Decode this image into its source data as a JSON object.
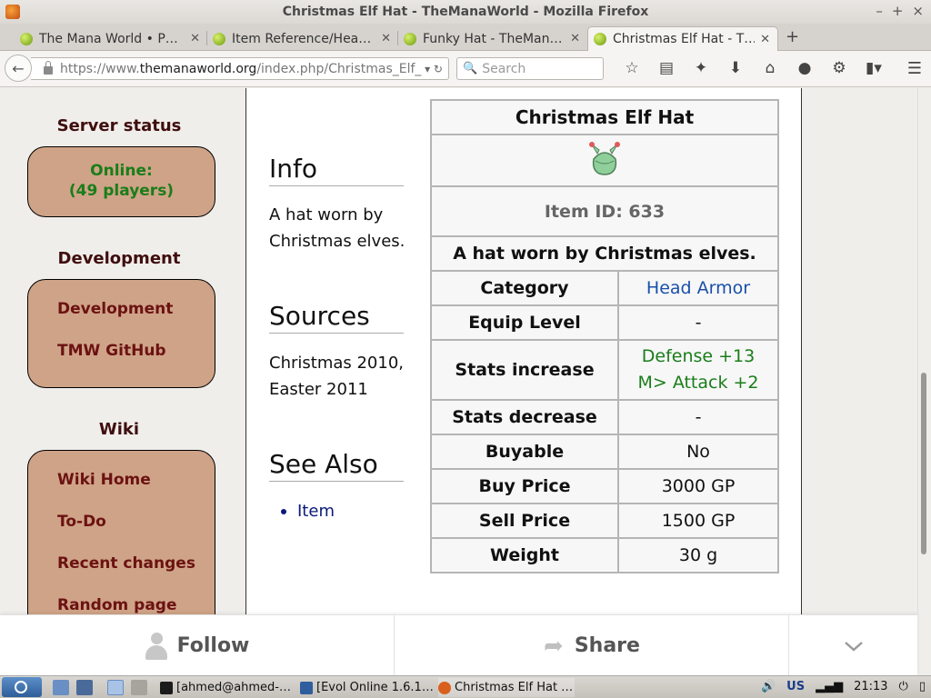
{
  "window": {
    "title": "Christmas Elf Hat - TheManaWorld - Mozilla Firefox",
    "controls": [
      "–",
      "+",
      "×"
    ]
  },
  "tabs": [
    {
      "label": "The Mana World • P…",
      "active": false
    },
    {
      "label": "Item Reference/Hea…",
      "active": false
    },
    {
      "label": "Funky Hat - TheMan…",
      "active": false
    },
    {
      "label": "Christmas Elf Hat - T…",
      "active": true
    }
  ],
  "new_tab_label": "+",
  "navbar": {
    "url_prefix": "https://www.",
    "url_host": "themanaworld.org",
    "url_path": "/index.php/Christmas_Elf_",
    "search_placeholder": "Search"
  },
  "sidebar": {
    "server_status_heading": "Server status",
    "status_line1": "Online:",
    "status_line2": "(49 players)",
    "development_heading": "Development",
    "development_links": [
      "Development",
      "TMW GitHub"
    ],
    "wiki_heading": "Wiki",
    "wiki_links": [
      "Wiki Home",
      "To-Do",
      "Recent changes",
      "Random page"
    ]
  },
  "content": {
    "info_heading": "Info",
    "info_text": "A hat worn by Christmas elves.",
    "sources_heading": "Sources",
    "sources_text": "Christmas 2010, Easter 2011",
    "see_also_heading": "See Also",
    "see_also_items": [
      "Item"
    ]
  },
  "item_table": {
    "title": "Christmas Elf Hat",
    "item_id": "Item ID: 633",
    "description": "A hat worn by Christmas elves.",
    "rows": [
      {
        "key": "Category",
        "value": "Head Armor"
      },
      {
        "key": "Equip Level",
        "value": "-"
      },
      {
        "key": "Stats increase",
        "value_line1": "Defense +13",
        "value_line2": "M> Attack +2"
      },
      {
        "key": "Stats decrease",
        "value": "-"
      },
      {
        "key": "Buyable",
        "value": "No"
      },
      {
        "key": "Buy Price",
        "value": "3000 GP"
      },
      {
        "key": "Sell Price",
        "value": "1500 GP"
      },
      {
        "key": "Weight",
        "value": "30 g"
      }
    ]
  },
  "bottom_bar": {
    "follow_label": "Follow",
    "share_label": "Share"
  },
  "taskbar": {
    "tasks": [
      "[ahmed@ahmed-…",
      "[Evol Online 1.6.1…",
      "Christmas Elf Hat …"
    ],
    "keyboard_layout": "US",
    "clock": "21:13"
  },
  "colors": {
    "sidebar_box": "#cfa387",
    "sidebar_link": "#6b1212",
    "online_green": "#1a7d1a",
    "link_blue": "#1a4faa"
  }
}
